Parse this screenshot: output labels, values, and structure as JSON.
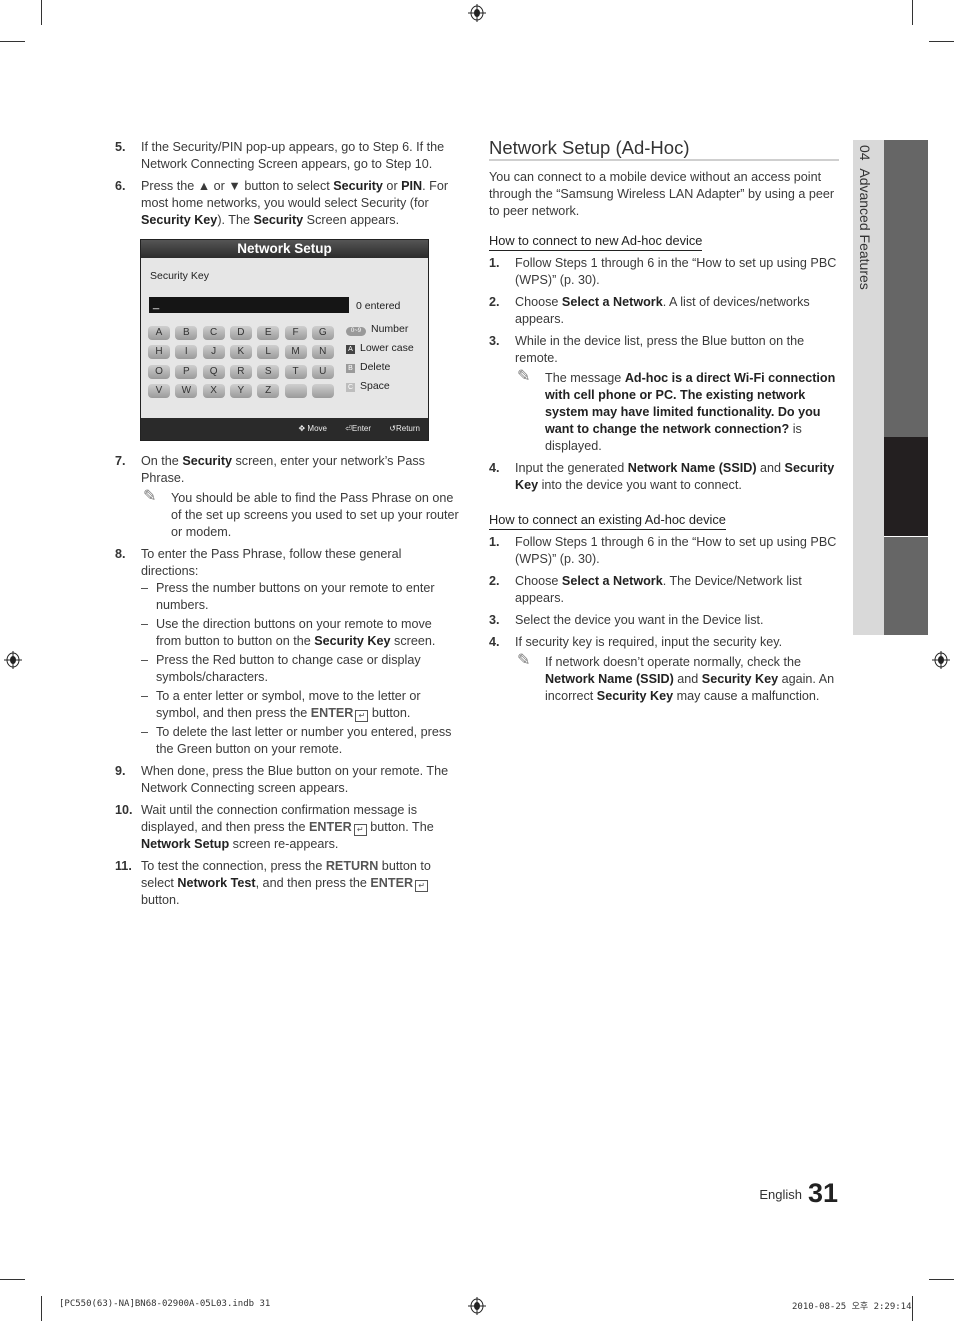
{
  "left_column": {
    "steps": [
      {
        "num": "5.",
        "html_parts": [
          {
            "t": "If the Security/PIN pop-up appears, go to Step 6. If the Network Connecting Screen appears, go to Step 10."
          }
        ]
      },
      {
        "num": "6.",
        "html_parts": [
          {
            "t": "Press the ▲ or ▼ button to select "
          },
          {
            "b": "Security"
          },
          {
            "t": " or "
          },
          {
            "b": "PIN"
          },
          {
            "t": ". For most home networks, you would select Security (for "
          },
          {
            "b": "Security Key"
          },
          {
            "t": "). The "
          },
          {
            "b": "Security"
          },
          {
            "t": " Screen appears."
          }
        ]
      }
    ],
    "tv_screen": {
      "title": "Network Setup",
      "field_label": "Security Key",
      "input_value": "_",
      "entered_count": "0 entered",
      "keys": [
        "A",
        "B",
        "C",
        "D",
        "E",
        "F",
        "G",
        "H",
        "I",
        "J",
        "K",
        "L",
        "M",
        "N",
        "O",
        "P",
        "Q",
        "R",
        "S",
        "T",
        "U",
        "V",
        "W",
        "X",
        "Y",
        "Z",
        "",
        ""
      ],
      "legend": [
        {
          "badge": "0~9",
          "label": "Number"
        },
        {
          "badge": "A",
          "label": "Lower case",
          "color": "#444444"
        },
        {
          "badge": "B",
          "label": "Delete",
          "color": "#9a9a9a"
        },
        {
          "badge": "C",
          "label": "Space",
          "color": "#bdbdbd"
        }
      ],
      "footer": {
        "move": "Move",
        "enter": "Enter",
        "return": "Return"
      }
    },
    "steps2": [
      {
        "num": "7.",
        "html_parts": [
          {
            "t": "On the "
          },
          {
            "b": "Security"
          },
          {
            "t": " screen, enter your network’s Pass Phrase."
          }
        ],
        "note": "You should be able to find the Pass Phrase on one of the set up screens you used to set up your router or modem."
      },
      {
        "num": "8.",
        "html_parts": [
          {
            "t": "To enter the Pass Phrase, follow these general directions:"
          }
        ],
        "dashes": [
          [
            {
              "t": "Press the number buttons on your remote to enter numbers."
            }
          ],
          [
            {
              "t": "Use the direction buttons on your remote to move from button to button on the "
            },
            {
              "b": "Security Key"
            },
            {
              "t": " screen."
            }
          ],
          [
            {
              "t": "Press the Red button to change case or display symbols/characters."
            }
          ],
          [
            {
              "t": "To a enter letter or symbol, move to the letter or symbol, and then press the "
            },
            {
              "h": "ENTER"
            },
            {
              "icon": "enter"
            },
            {
              "t": " button."
            }
          ],
          [
            {
              "t": "To delete the last letter or number you entered, press the Green button on your remote."
            }
          ]
        ]
      },
      {
        "num": "9.",
        "html_parts": [
          {
            "t": "When done, press the Blue button on your remote. The Network Connecting screen appears."
          }
        ]
      },
      {
        "num": "10.",
        "html_parts": [
          {
            "t": "Wait until the connection confirmation message is displayed, and then press the "
          },
          {
            "h": "ENTER"
          },
          {
            "icon": "enter"
          },
          {
            "t": " button. The "
          },
          {
            "b": "Network Setup"
          },
          {
            "t": " screen re-appears."
          }
        ]
      },
      {
        "num": "11.",
        "html_parts": [
          {
            "t": "To test the connection, press the "
          },
          {
            "h": "RETURN"
          },
          {
            "t": " button to select "
          },
          {
            "b": "Network Test"
          },
          {
            "t": ", and then press the "
          },
          {
            "h": "ENTER"
          },
          {
            "icon": "enter"
          },
          {
            "t": " button."
          }
        ]
      }
    ]
  },
  "right_column": {
    "title": "Network Setup (Ad-Hoc)",
    "intro": "You can connect to a mobile device without an access point through the “Samsung Wireless LAN Adapter” by using a peer to peer network.",
    "sections": [
      {
        "heading": "How to connect to new Ad-hoc device",
        "steps": [
          {
            "num": "1.",
            "html_parts": [
              {
                "t": "Follow Steps 1 through 6 in the “How to set up using PBC (WPS)” (p. 30)."
              }
            ]
          },
          {
            "num": "2.",
            "html_parts": [
              {
                "t": "Choose "
              },
              {
                "b": "Select a Network"
              },
              {
                "t": ". A list of devices/networks appears."
              }
            ]
          },
          {
            "num": "3.",
            "html_parts": [
              {
                "t": "While in the device list, press the Blue button on the remote."
              }
            ],
            "note_parts": [
              {
                "t": "The message "
              },
              {
                "b": "Ad-hoc is a direct Wi-Fi connection with cell phone or PC. The existing network system may have limited functionality. Do you want to change the network connection?"
              },
              {
                "t": " is displayed."
              }
            ]
          },
          {
            "num": "4.",
            "html_parts": [
              {
                "t": "Input the generated "
              },
              {
                "b": "Network Name (SSID)"
              },
              {
                "t": " and "
              },
              {
                "b": "Security Key"
              },
              {
                "t": " into the device you want to connect."
              }
            ]
          }
        ]
      },
      {
        "heading": "How to connect an existing Ad-hoc device",
        "steps": [
          {
            "num": "1.",
            "html_parts": [
              {
                "t": "Follow Steps 1 through 6 in the “How to set up using PBC (WPS)” (p. 30)."
              }
            ]
          },
          {
            "num": "2.",
            "html_parts": [
              {
                "t": "Choose "
              },
              {
                "b": "Select a Network"
              },
              {
                "t": ". The Device/Network list appears."
              }
            ]
          },
          {
            "num": "3.",
            "html_parts": [
              {
                "t": "Select the device you want in the Device list."
              }
            ]
          },
          {
            "num": "4.",
            "html_parts": [
              {
                "t": "If security key is required, input the security key."
              }
            ],
            "note_parts": [
              {
                "t": "If network doesn’t operate normally, check the "
              },
              {
                "b": "Network Name (SSID)"
              },
              {
                "t": " and "
              },
              {
                "b": "Security Key"
              },
              {
                "t": " again. An incorrect "
              },
              {
                "b": "Security Key"
              },
              {
                "t": " may cause a malfunction."
              }
            ]
          }
        ]
      }
    ]
  },
  "side_tab": {
    "chapter": "04",
    "label": "Advanced Features"
  },
  "footer": {
    "language": "English",
    "page_number": "31"
  },
  "print_slug": {
    "file": "[PC550(63)-NA]BN68-02900A-05L03.indb   31",
    "timestamp": "2010-08-25   오후 2:29:14"
  },
  "icons": {
    "note": "pencil-note-icon",
    "enter": "enter-icon",
    "registration": "registration-mark-icon"
  }
}
